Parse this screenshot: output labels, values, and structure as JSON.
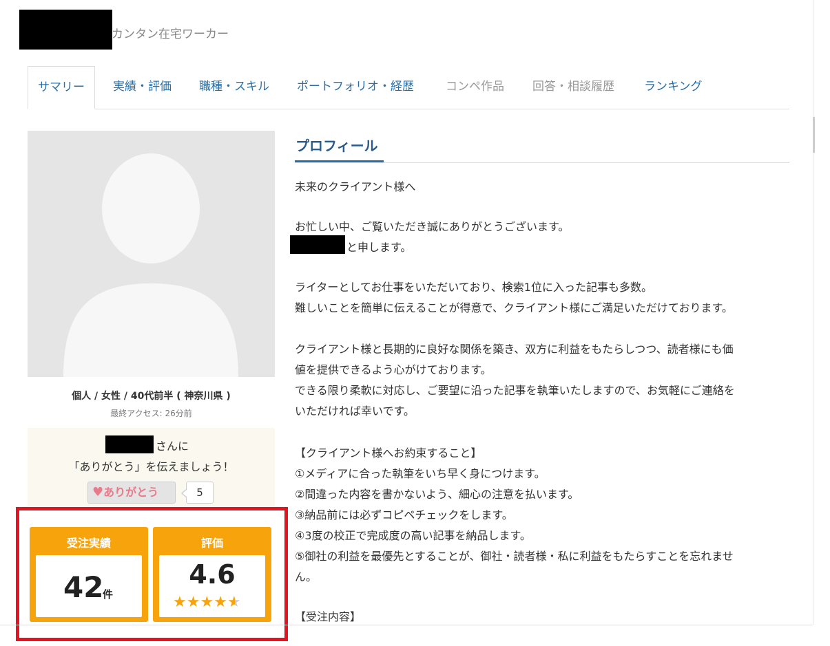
{
  "header": {
    "role": "カンタン在宅ワーカー"
  },
  "tabs": [
    {
      "label": "サマリー"
    },
    {
      "label": "実績・評価"
    },
    {
      "label": "職種・スキル"
    },
    {
      "label": "ポートフォリオ・経歴"
    },
    {
      "label": "コンペ作品"
    },
    {
      "label": "回答・相談履歴"
    },
    {
      "label": "ランキング"
    }
  ],
  "profile_meta": {
    "demographics": "個人 / 女性 / 40代前半 ( 神奈川県 )",
    "last_access": "最終アクセス: 26分前"
  },
  "thanks": {
    "line1_suffix": "さんに",
    "line2": "「ありがとう」を伝えましょう！",
    "button_label": "ありがとう",
    "count": "5"
  },
  "stats": {
    "orders": {
      "title": "受注実績",
      "value": "42",
      "unit": "件"
    },
    "rating": {
      "title": "評価",
      "value": "4.6",
      "stars": 4.6
    }
  },
  "colors": {
    "accent_orange": "#f7a30c",
    "highlight_red": "#e11422",
    "link_blue": "#2a6fa8"
  },
  "profile": {
    "title": "プロフィール",
    "lines": [
      "未来のクライアント様へ",
      "お忙しい中、ご覧いただき誠にありがとうございます。",
      "と申します。",
      "ライターとしてお仕事をいただいており、検索1位に入った記事も多数。",
      "難しいことを簡単に伝えることが得意で、クライアント様にご満足いただけております。",
      "クライアント様と長期的に良好な関係を築き、双方に利益をもたらしつつ、読者様にも価",
      "値を提供できるよう心がけております。",
      "できる限り柔軟に対応し、ご要望に沿った記事を執筆いたしますので、お気軽にご連絡を",
      "いただければ幸いです。",
      "【クライアント様へお約束すること】",
      "①メディアに合った執筆をいち早く身につけます。",
      "②間違った内容を書かないよう、細心の注意を払います。",
      "③納品前には必ずコピペチェックをします。",
      "④3度の校正で完成度の高い記事を納品します。",
      "⑤御社の利益を最優先とすることが、御社・読者様・私に利益をもたらすことを忘れませ",
      "ん。",
      "【受注内容】"
    ]
  }
}
